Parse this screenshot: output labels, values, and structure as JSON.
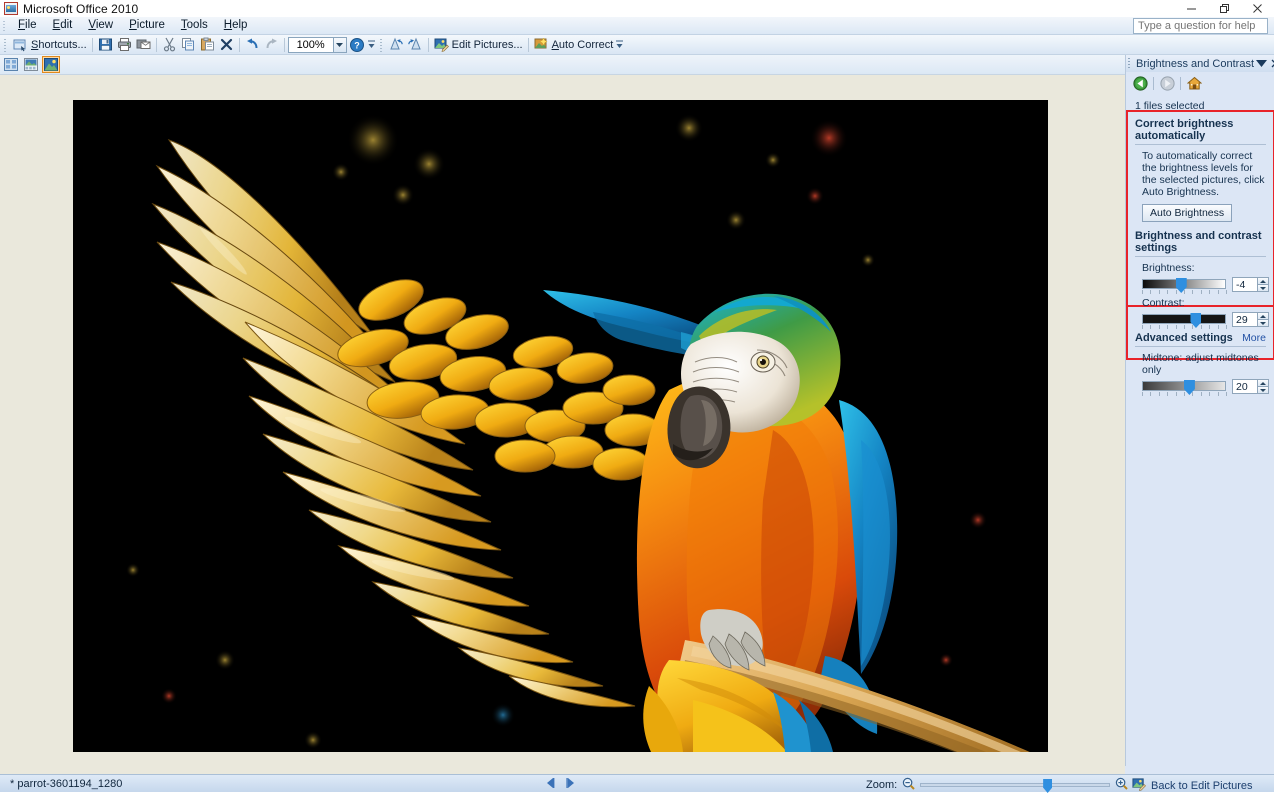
{
  "window": {
    "title": "Microsoft Office 2010",
    "app_icon": "office-picture-manager-icon",
    "minimize": "minimize-icon",
    "maximize": "restore-icon",
    "close": "close-icon"
  },
  "menubar": {
    "items": [
      {
        "label": "File",
        "accel": "F"
      },
      {
        "label": "Edit",
        "accel": "E"
      },
      {
        "label": "View",
        "accel": "V"
      },
      {
        "label": "Picture",
        "accel": "P"
      },
      {
        "label": "Tools",
        "accel": "T"
      },
      {
        "label": "Help",
        "accel": "H"
      }
    ]
  },
  "help": {
    "placeholder": "Type a question for help",
    "value": ""
  },
  "toolbar": {
    "shortcuts_label": "Shortcuts...",
    "save_label": "Save",
    "print_label": "Print",
    "email_label": "E-mail",
    "cut_label": "Cut",
    "copy_label": "Copy",
    "paste_label": "Paste",
    "delete_label": "Delete",
    "undo_label": "Undo",
    "redo_label": "Redo",
    "zoom_value": "100%",
    "help_label": "Microsoft Office Picture Manager Help",
    "rotate_left_label": "Rotate Left",
    "rotate_right_label": "Rotate Right",
    "edit_pictures_label": "Edit Pictures...",
    "auto_correct_label": "Auto Correct",
    "overflow_label": "Toolbar Options"
  },
  "viewbar": {
    "thumbnail_label": "Thumbnail View",
    "filmstrip_label": "Filmstrip View",
    "single_label": "Single Picture View",
    "selected": "single"
  },
  "taskpane": {
    "title": "Brightness and Contrast",
    "dropdown_icon": "chevron-down-icon",
    "close_icon": "close-icon",
    "nav": {
      "back_label": "Back",
      "forward_label": "Forward",
      "home_label": "Home"
    },
    "files_selected": "1 files selected",
    "auto_section": {
      "heading": "Correct brightness automatically",
      "description": "To automatically correct the brightness levels for the selected pictures, click Auto Brightness.",
      "button_label": "Auto Brightness"
    },
    "settings_section": {
      "heading": "Brightness and contrast settings",
      "sliders": [
        {
          "label": "Brightness:",
          "value": "-4",
          "thumb_pct": 46
        },
        {
          "label": "Contrast:",
          "value": "29",
          "thumb_pct": 64
        }
      ]
    },
    "advanced_section": {
      "heading": "Advanced settings",
      "more_label": "More",
      "slider": {
        "label": "Midtone: adjust midtones only",
        "value": "20",
        "thumb_pct": 56
      }
    },
    "highlight_color": "#e8232a"
  },
  "statusbar": {
    "filename": "* parrot-3601194_1280",
    "prev_icon": "previous-icon",
    "next_icon": "next-icon",
    "zoom_label": "Zoom:",
    "zoom_out_icon": "zoom-out-icon",
    "zoom_in_icon": "zoom-in-icon",
    "zoom_thumb_pct": 67,
    "back_to_edit_label": "Back to Edit Pictures",
    "back_to_edit_icon": "edit-pictures-icon"
  },
  "photo": {
    "alt": "Blue and gold macaw parrot with spread wing perched on a branch",
    "background": "#000000"
  },
  "colors": {
    "workspace_bg": "#eae8dc",
    "pane_bg": "#dce6f5",
    "accent_blue": "#2f8fe0",
    "red_outline": "#e8232a"
  }
}
